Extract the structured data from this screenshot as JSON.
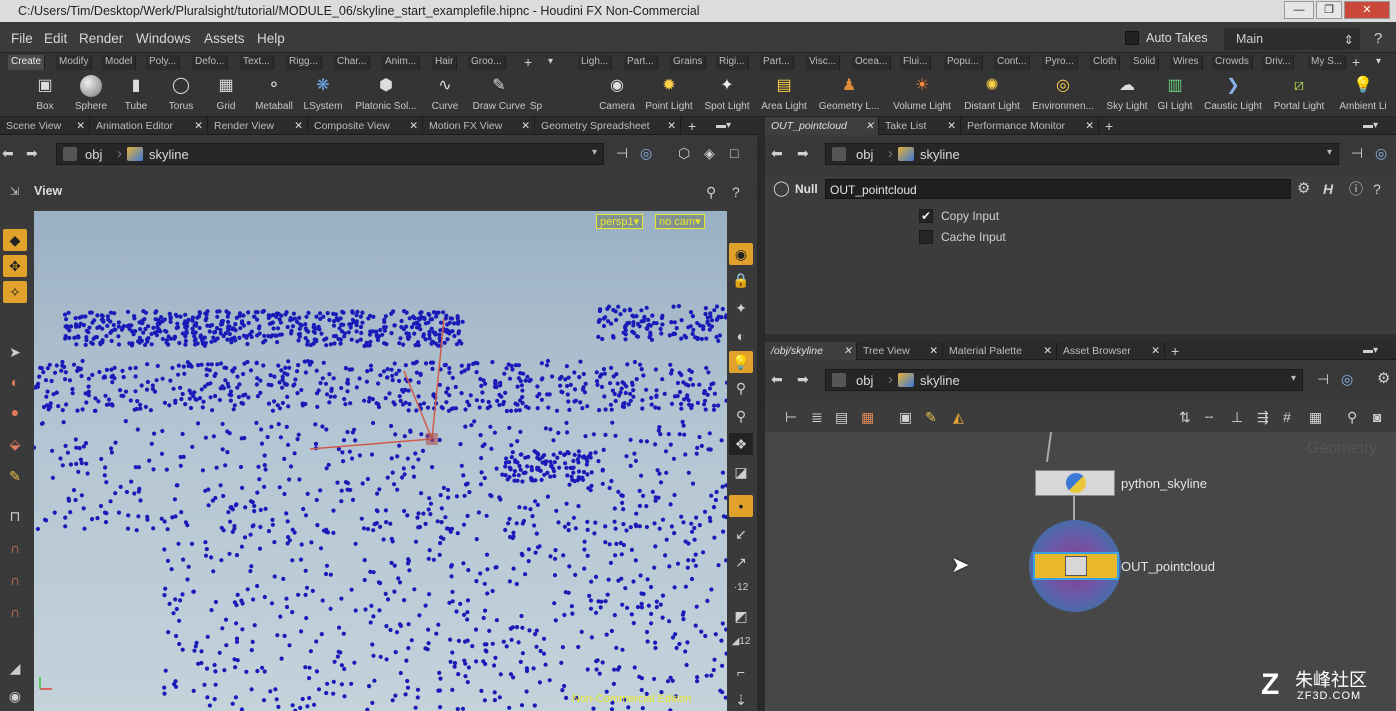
{
  "window": {
    "title": "C:/Users/Tim/Desktop/Werk/Pluralsight/tutorial/MODULE_06/skyline_start_examplefile.hipnc - Houdini FX Non-Commercial"
  },
  "menu": [
    "File",
    "Edit",
    "Render",
    "Windows",
    "Assets",
    "Help"
  ],
  "auto_takes": "Auto Takes",
  "take": "Main",
  "shelf_left_tabs": [
    "Create",
    "Modify",
    "Model",
    "Poly...",
    "Defo...",
    "Text...",
    "Rigg...",
    "Char...",
    "Anim...",
    "Hair",
    "Groo..."
  ],
  "shelf_right_tabs": [
    "Ligh...",
    "Part...",
    "Grains",
    "Rigi...",
    "Part...",
    "Visc...",
    "Ocea...",
    "Flui...",
    "Popu...",
    "Cont...",
    "Pyro...",
    "Cloth",
    "Solid",
    "Wires",
    "Crowds",
    "Driv...",
    "My S..."
  ],
  "create_tools": [
    "Box",
    "Sphere",
    "Tube",
    "Torus",
    "Grid",
    "Metaball",
    "LSystem",
    "Platonic Sol...",
    "Curve",
    "Draw Curve",
    "Sp"
  ],
  "light_tools": [
    "Camera",
    "Point Light",
    "Spot Light",
    "Area Light",
    "Geometry L...",
    "Volume Light",
    "Distant Light",
    "Environmen...",
    "Sky Light",
    "GI Light",
    "Caustic Light",
    "Portal Light",
    "Ambient Li"
  ],
  "left_pane_tabs": [
    "Scene View",
    "Animation Editor",
    "Render View",
    "Composite View",
    "Motion FX View",
    "Geometry Spreadsheet"
  ],
  "path": {
    "root": "obj",
    "node": "skyline"
  },
  "viewer": {
    "label": "View",
    "persp": "persp1",
    "cam": "no cam",
    "watermark": "Non-Commercial Edition"
  },
  "param_tabs": [
    "OUT_pointcloud",
    "Take List",
    "Performance Monitor"
  ],
  "param": {
    "type": "Null",
    "name": "OUT_pointcloud",
    "copy_input": "Copy Input",
    "cache_input": "Cache Input"
  },
  "net_tabs": [
    "/obj/skyline",
    "Tree View",
    "Material Palette",
    "Asset Browser"
  ],
  "nodes": {
    "python": "python_skyline",
    "out": "OUT_pointcloud",
    "context": "Geometry"
  },
  "brand": {
    "logo_text": "朱峰社区",
    "logo_sub": "ZF3D.COM"
  },
  "colors": {
    "accent": "#e0a22a",
    "points": "#1a1ab8",
    "node_out": "#e8b72a",
    "node_ring": "#5e6cb5"
  }
}
